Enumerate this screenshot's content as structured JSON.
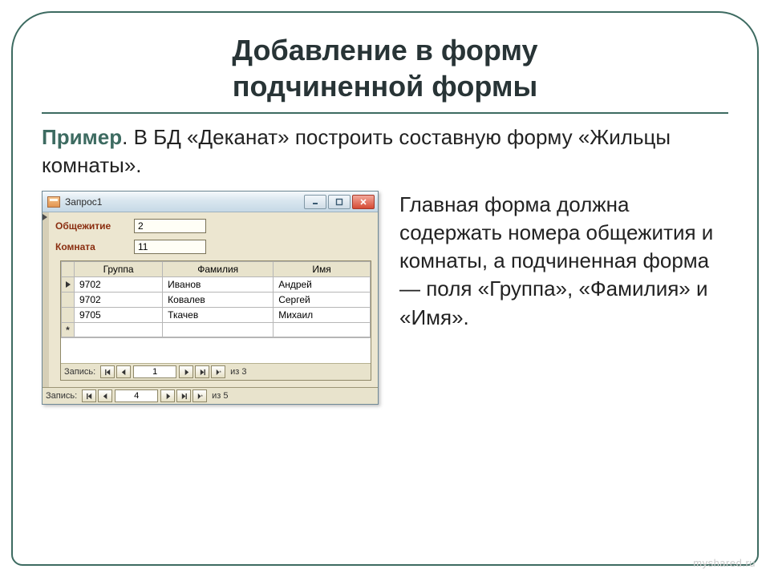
{
  "slide": {
    "title_line1": "Добавление в форму",
    "title_line2": "подчиненной формы",
    "example_label": "Пример",
    "example_text": ". В БД «Деканат» построить составную форму «Жильцы комнаты».",
    "description": "Главная форма должна содержать номера общежития и комнаты, а подчиненная форма — поля  «Группа», «Фамилия» и «Имя».",
    "watermark": "myshared.ru"
  },
  "window": {
    "title": "Запрос1",
    "fields": {
      "dorm_label": "Общежитие",
      "dorm_value": "2",
      "room_label": "Комната",
      "room_value": "11"
    },
    "subform": {
      "headers": {
        "group": "Группа",
        "lastname": "Фамилия",
        "firstname": "Имя"
      },
      "rows": [
        {
          "group": "9702",
          "lastname": "Иванов",
          "firstname": "Андрей"
        },
        {
          "group": "9702",
          "lastname": "Ковалев",
          "firstname": "Сергей"
        },
        {
          "group": "9705",
          "lastname": "Ткачев",
          "firstname": "Михаил"
        }
      ],
      "nav": {
        "label": "Запись:",
        "current": "1",
        "of_prefix": "из",
        "total": "3"
      }
    },
    "nav": {
      "label": "Запись:",
      "current": "4",
      "of_prefix": "из",
      "total": "5"
    }
  }
}
